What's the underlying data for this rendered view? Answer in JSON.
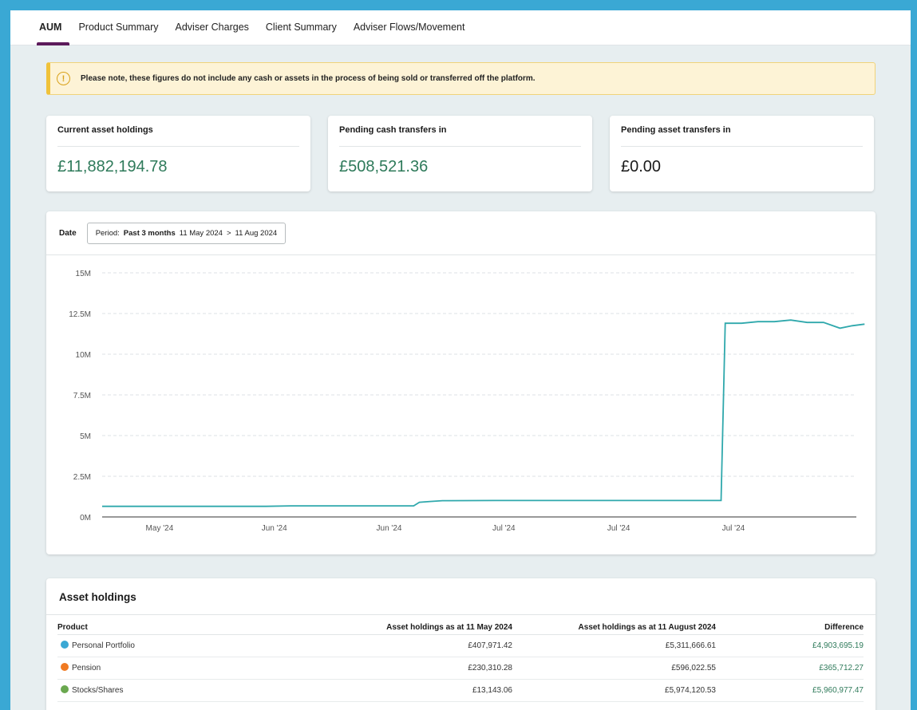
{
  "tabs": [
    {
      "label": "AUM",
      "active": true
    },
    {
      "label": "Product Summary",
      "active": false
    },
    {
      "label": "Adviser Charges",
      "active": false
    },
    {
      "label": "Client Summary",
      "active": false
    },
    {
      "label": "Adviser Flows/Movement",
      "active": false
    }
  ],
  "notice": {
    "icon": "warning-circle-icon",
    "text": "Please note, these figures do not include any cash or assets in the process of being sold or transferred off the platform."
  },
  "stats": [
    {
      "label": "Current asset holdings",
      "value": "£11,882,194.78"
    },
    {
      "label": "Pending cash transfers in",
      "value": "£508,521.36"
    },
    {
      "label": "Pending asset transfers in",
      "value": "£0.00"
    }
  ],
  "filter": {
    "date_label": "Date",
    "period_prefix": "Period:",
    "period_name": "Past 3 months",
    "start": "11 May 2024",
    "separator": ">",
    "end": "11 Aug 2024"
  },
  "chart_data": {
    "type": "line",
    "title": "",
    "xlabel": "",
    "ylabel": "",
    "ylim": [
      0,
      15000000
    ],
    "y_ticks": [
      "0M",
      "2.5M",
      "5M",
      "7.5M",
      "10M",
      "12.5M",
      "15M"
    ],
    "y_tick_values": [
      0,
      2500000,
      5000000,
      7500000,
      10000000,
      12500000,
      15000000
    ],
    "x_ticks": [
      "May '24",
      "Jun '24",
      "Jun '24",
      "Jul '24",
      "Jul '24",
      "Jul '24"
    ],
    "x_tick_days": [
      7,
      21,
      35,
      49,
      63,
      77
    ],
    "x_range_days": [
      0,
      92
    ],
    "grid": true,
    "line_color": "#2fa8ac",
    "series": [
      {
        "name": "",
        "x": [
          0,
          10,
          20,
          23,
          31,
          38,
          38.7,
          40,
          41.5,
          42,
          48,
          56,
          66,
          75.5,
          76,
          78,
          80,
          82,
          84,
          86,
          88,
          90,
          91.5,
          93
        ],
        "values": [
          650000,
          650000,
          650000,
          680000,
          680000,
          680000,
          900000,
          950000,
          1000000,
          1000000,
          1010000,
          1010000,
          1010000,
          1010000,
          11900000,
          11900000,
          12000000,
          12000000,
          12100000,
          11950000,
          11950000,
          11600000,
          11750000,
          11850000
        ]
      }
    ]
  },
  "holdings": {
    "title": "Asset holdings",
    "columns": [
      "Product",
      "Asset holdings as at 11 May 2024",
      "Asset holdings as at 11 August 2024",
      "Difference"
    ],
    "rows": [
      {
        "product": "Personal Portfolio",
        "color": "#3aa8d4",
        "may": "£407,971.42",
        "aug": "£5,311,666.61",
        "diff": "£4,903,695.19"
      },
      {
        "product": "Pension",
        "color": "#f07a22",
        "may": "£230,310.28",
        "aug": "£596,022.55",
        "diff": "£365,712.27"
      },
      {
        "product": "Stocks/Shares",
        "color": "#6aa84f",
        "may": "£13,143.06",
        "aug": "£5,974,120.53",
        "diff": "£5,960,977.47"
      }
    ]
  }
}
